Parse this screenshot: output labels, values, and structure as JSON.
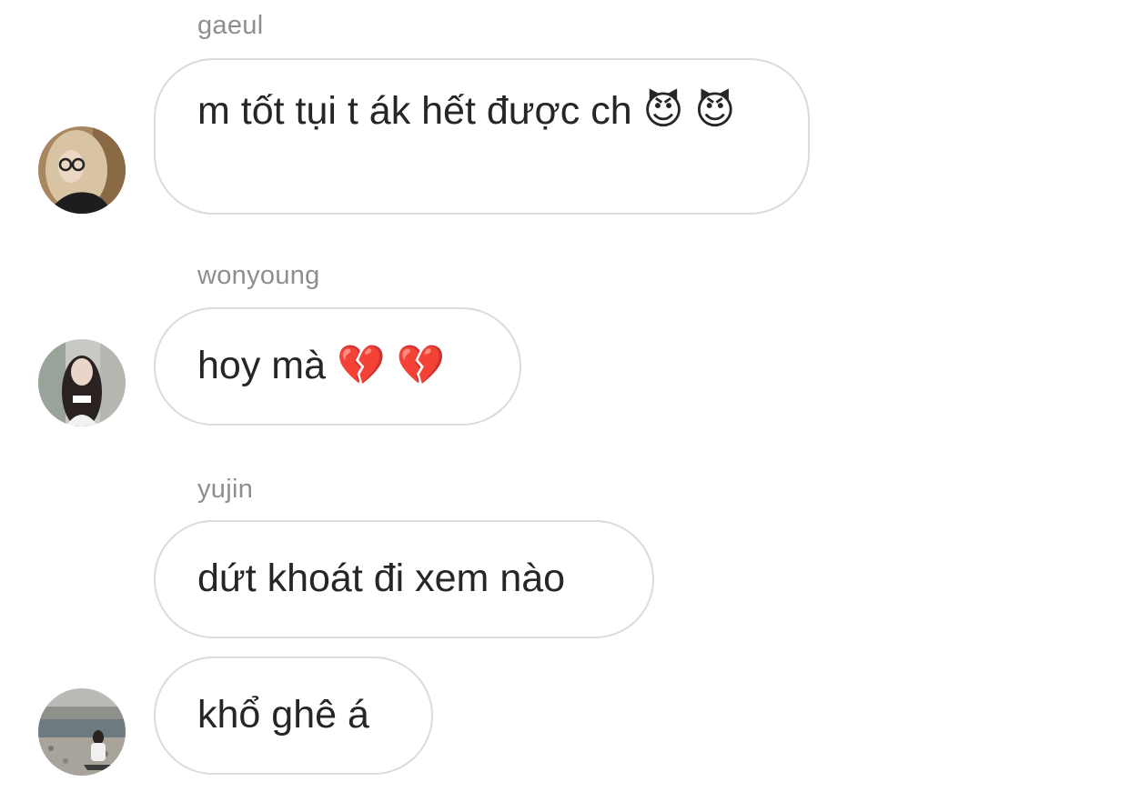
{
  "messages": [
    {
      "username": "gaeul",
      "text": "m tốt tụi t ák hết được ch 😈 😈",
      "avatar": "girl-with-glasses-avatar"
    },
    {
      "username": "wonyoung",
      "text": "hoy mà 💔 💔",
      "avatar": "girl-long-dark-hair-avatar"
    },
    {
      "username": "yujin",
      "text": "dứt khoát đi xem nào",
      "avatar": null
    },
    {
      "username": "",
      "text": "khổ ghê á",
      "avatar": "girl-at-beach-avatar"
    }
  ],
  "colors": {
    "bubble_border": "#dbdbdb",
    "username": "#8e8e8e",
    "text": "#262626"
  }
}
